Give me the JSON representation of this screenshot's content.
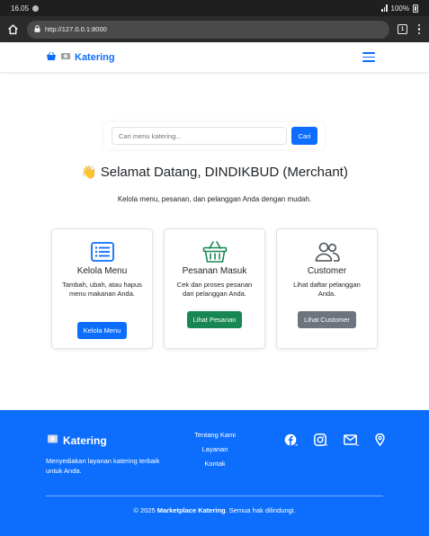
{
  "status_bar": {
    "time": "16.05",
    "battery": "100%"
  },
  "browser": {
    "url": "http://127.0.0.1:8000",
    "tab_count": "1"
  },
  "navbar": {
    "brand": "Katering"
  },
  "search": {
    "placeholder": "Cari menu katering...",
    "button_label": "Cari"
  },
  "welcome": {
    "emoji": "👋",
    "title": "Selamat Datang, DINDIKBUD (Merchant)",
    "subtitle": "Kelola menu, pesanan, dan pelanggan Anda dengan mudah."
  },
  "cards": [
    {
      "icon": "list-icon",
      "title": "Kelola Menu",
      "text": "Tambah, ubah, atau hapus menu makanan Anda.",
      "button": "Kelola Menu"
    },
    {
      "icon": "basket-icon",
      "title": "Pesanan Masuk",
      "text": "Cek dan proses pesanan dari pelanggan Anda.",
      "button": "Lihat Pesanan"
    },
    {
      "icon": "people-icon",
      "title": "Customer",
      "text": "Lihat daftar pelanggan Anda.",
      "button": "Lihat Customer"
    }
  ],
  "footer": {
    "brand": "Katering",
    "description": "Menyediakan layanan katering terbaik untuk Anda.",
    "links": [
      "Tentang Kami",
      "Layanan",
      "Kontak"
    ],
    "social_icons": [
      "facebook-icon",
      "instagram-icon",
      "email-icon",
      "location-icon"
    ],
    "copyright_prefix": "© 2025",
    "copyright_brand": "Marketplace Katering",
    "copyright_suffix": ". Semua hak dilindungi."
  },
  "colors": {
    "primary": "#0d6efd",
    "success": "#198754",
    "secondary": "#6c757d"
  }
}
